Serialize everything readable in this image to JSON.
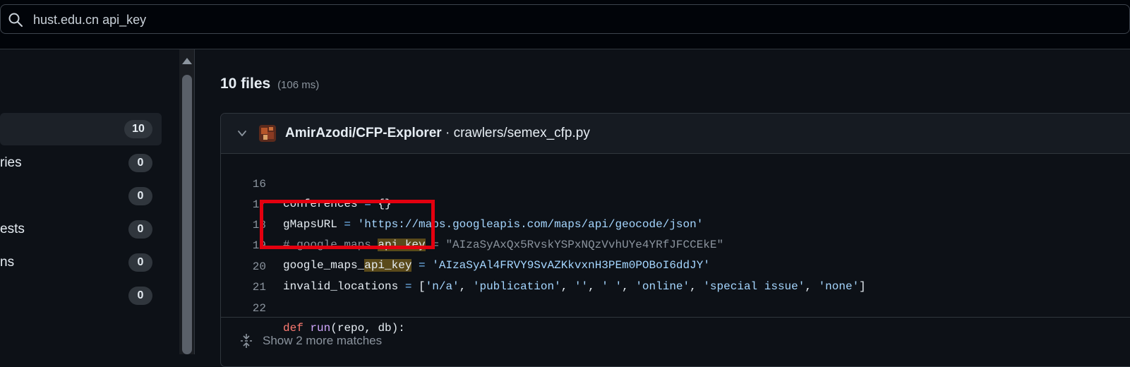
{
  "search": {
    "query": "hust.edu.cn api_key",
    "icon": "search-icon"
  },
  "sidebar": {
    "items": [
      {
        "label": "",
        "count": "10"
      },
      {
        "label": "ries",
        "count": "0"
      },
      {
        "label": "",
        "count": "0"
      },
      {
        "label": "ests",
        "count": "0"
      },
      {
        "label": "ns",
        "count": "0"
      },
      {
        "label": "",
        "count": "0"
      }
    ]
  },
  "results": {
    "count_label": "10 files",
    "time_label": "(106 ms)"
  },
  "result": {
    "repo": "AmirAzodi/CFP-Explorer",
    "separator": " · ",
    "path": "crawlers/semex_cfp.py",
    "lines": [
      {
        "num": "16",
        "code": "conferences = {}"
      },
      {
        "num": "17",
        "code": "gMapsURL = 'https://maps.googleapis.com/maps/api/geocode/json'"
      },
      {
        "num": "18",
        "code": "# google_maps_api_key = \"AIzaSyAxQx5RvskYSPxNQzVvhUYe4YRfJFCCEkE\""
      },
      {
        "num": "19",
        "code": "google_maps_api_key = 'AIzaSyAl4FRVY9SvAZKkvxnH3PEm0POBoI6ddJY'"
      },
      {
        "num": "20",
        "code": "invalid_locations = ['n/a', 'publication', '', ' ', 'online', 'special issue', 'none']"
      },
      {
        "num": "21",
        "code": ""
      },
      {
        "num": "22",
        "code": "def run(repo, db):"
      }
    ],
    "tokens": {
      "l16a": "conferences ",
      "l16b": "=",
      "l16c": " {}",
      "l17a": "gMapsURL ",
      "l17b": "=",
      "l17c": " ",
      "l17d": "'https://maps.googleapis.com/maps/api/geocode/json'",
      "l18a": "# google_maps_",
      "l18b": "api_key",
      "l18c": " = \"AIzaSyAxQx5RvskYSPxNQzVvhUYe4YRfJFCCEkE\"",
      "l19a": "google_maps_",
      "l19b": "api_key",
      "l19c": " ",
      "l19d": "=",
      "l19e": " ",
      "l19f": "'AIzaSyAl4FRVY9SvAZKkvxnH3PEm0POBoI6ddJY'",
      "l20a": "invalid_locations ",
      "l20b": "=",
      "l20c": " [",
      "l20d": "'n/a'",
      "l20e": ", ",
      "l20f": "'publication'",
      "l20g": ", ",
      "l20h": "''",
      "l20i": ", ",
      "l20j": "' '",
      "l20k": ", ",
      "l20l": "'online'",
      "l20m": ", ",
      "l20n": "'special issue'",
      "l20o": ", ",
      "l20p": "'none'",
      "l20q": "]",
      "l22a": "def",
      "l22b": " ",
      "l22c": "run",
      "l22d": "(repo, db):"
    },
    "more_label": "Show 2 more matches"
  },
  "colors": {
    "background": "#0d1117",
    "highlight": "#5a4a1a",
    "annotation": "#e4000f"
  }
}
